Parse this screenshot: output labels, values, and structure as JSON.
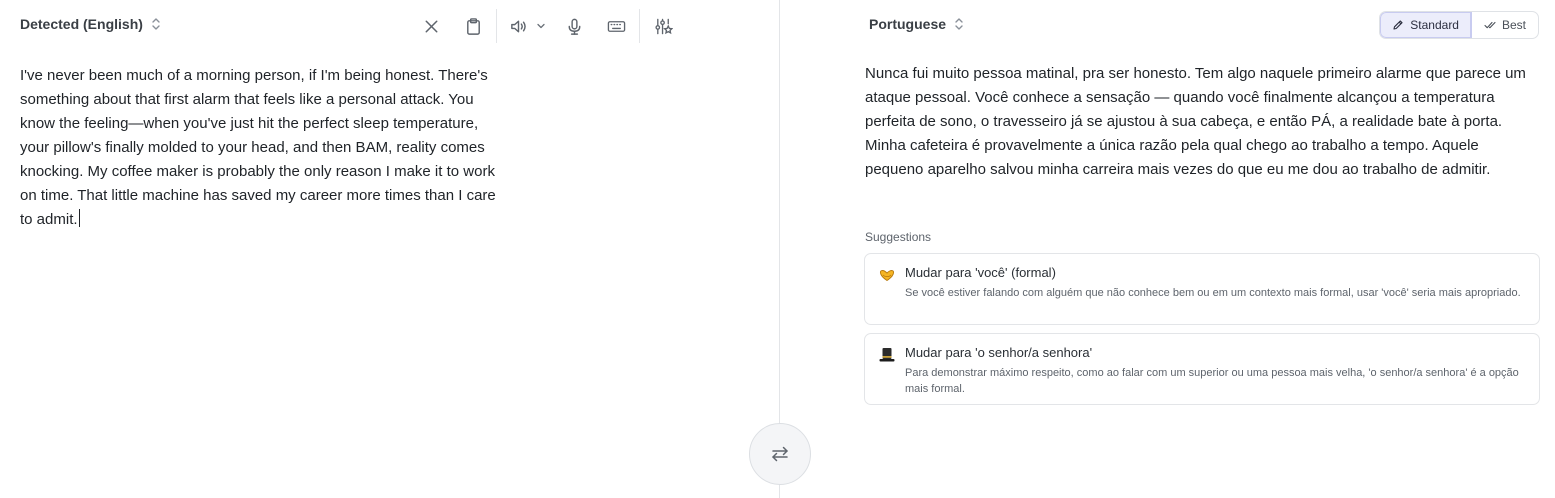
{
  "source": {
    "language_label": "Detected (English)",
    "text": "I've never been much of a morning person, if I'm being honest. There's\nsomething about that first alarm that feels like a personal attack. You\nknow the feeling—when you've just hit the perfect sleep temperature,\nyour pillow's finally molded to your head, and then BAM, reality comes\nknocking. My coffee maker is probably the only reason I make it to work\non time. That little machine has saved my career more times than I care\nto admit."
  },
  "toolbar": {
    "icons": [
      "close-icon",
      "clipboard-icon",
      "speaker-icon",
      "chevron-down-icon",
      "microphone-icon",
      "keyboard-icon",
      "settings-sliders-icon"
    ]
  },
  "target": {
    "language_label": "Portuguese",
    "text": "Nunca fui muito pessoa matinal, pra ser honesto. Tem algo naquele primeiro alarme que parece um ataque pessoal. Você conhece a sensação — quando você finalmente alcançou a temperatura perfeita de sono, o travesseiro já se ajustou à sua cabeça, e então PÁ, a realidade bate à porta. Minha cafeteira é provavelmente a única razão pela qual chego ao trabalho a tempo. Aquele pequeno aparelho salvou minha carreira mais vezes do que eu me dou ao trabalho de admitir."
  },
  "modes": {
    "standard": "Standard",
    "best": "Best",
    "active": "standard"
  },
  "suggestions": {
    "title": "Suggestions",
    "items": [
      {
        "icon": "heart-hands-icon",
        "title": "Mudar para 'você' (formal)",
        "description": "Se você estiver falando com alguém que não conhece bem ou em um contexto mais formal, usar 'você' seria mais apropriado."
      },
      {
        "icon": "top-hat-icon",
        "title": "Mudar para 'o senhor/a senhora'",
        "description": "Para demonstrar máximo respeito, como ao falar com um superior ou uma pessoa mais velha, 'o senhor/a senhora' é a opção mais formal."
      }
    ]
  },
  "colors": {
    "accent_bg": "#ecedfb",
    "divider": "#e3e5e8",
    "text": "#1f2328"
  }
}
